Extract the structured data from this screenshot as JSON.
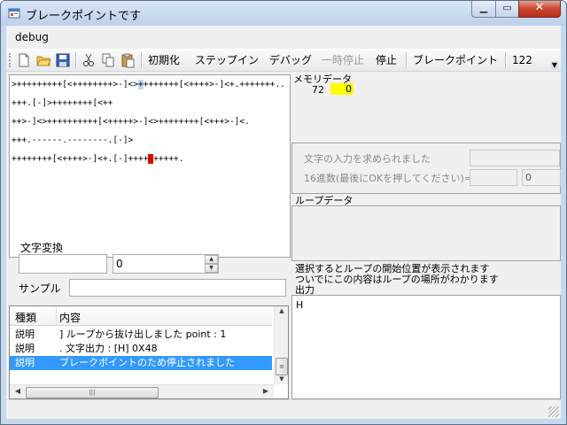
{
  "window": {
    "title": "ブレークポイントです"
  },
  "menu": {
    "items": [
      {
        "label": "debug"
      }
    ]
  },
  "toolbar": {
    "icons": [
      "new-file-icon",
      "open-folder-icon",
      "save-icon",
      "cut-icon",
      "copy-icon",
      "paste-icon"
    ],
    "buttons": [
      {
        "label": "初期化",
        "enabled": true
      },
      {
        "label": "ステップイン",
        "enabled": true
      },
      {
        "label": "デバッグ",
        "enabled": true
      },
      {
        "label": "一時停止",
        "enabled": false
      },
      {
        "label": "停止",
        "enabled": true
      },
      {
        "label": "ブレークポイント",
        "enabled": true
      }
    ],
    "counter": "122"
  },
  "code": {
    "lines": [
      {
        "before": ">+++++++++[<++++++++>-]<>",
        "mark": "+",
        "after": "+++++++[<++++>-]<+.+++++++.."
      },
      {
        "before": "+++.[-]>++++++++[<++",
        "mark": "",
        "after": ""
      },
      {
        "before": "++>-]<>++++++++++[<+++++>-]<>++++++++[<+++>-]<.",
        "mark": "",
        "after": ""
      },
      {
        "before": "+++.------.--------.[-]>",
        "mark": "",
        "after": ""
      },
      {
        "before": "++++++++[<++++>-]<+.[-]++++",
        "mark": "+",
        "after": "+++++."
      }
    ]
  },
  "memory": {
    "label": "メモリデータ",
    "address": "72",
    "value": "0"
  },
  "input": {
    "prompt_label": "文字の入力を求められました",
    "hex_label": "16進数(最後にOKを押してください)=>",
    "hex_value": "0"
  },
  "loop": {
    "label": "ループデータ",
    "hint_line1": "選択するとループの開始位置が表示されます",
    "hint_line2": "ついでにこの内容はループの場所がわかります"
  },
  "output": {
    "label": "出力",
    "text": "H"
  },
  "converter": {
    "label": "文字変換",
    "text_value": "",
    "number_value": "0",
    "sample_label": "サンプル",
    "sample_value": ""
  },
  "log": {
    "columns": [
      "種類",
      "内容"
    ],
    "rows": [
      {
        "type": "説明",
        "content": "] ループから抜け出しました point : 1"
      },
      {
        "type": "説明",
        "content": ". 文字出力 : [H] 0X48"
      },
      {
        "type": "説明",
        "content": "ブレークポイントのため停止されました"
      }
    ]
  },
  "colors": {
    "titlebar": "#c5d8ed",
    "breakpoint": "#e00000",
    "memory_highlight": "#ffff00",
    "selection": "#3399ff"
  }
}
